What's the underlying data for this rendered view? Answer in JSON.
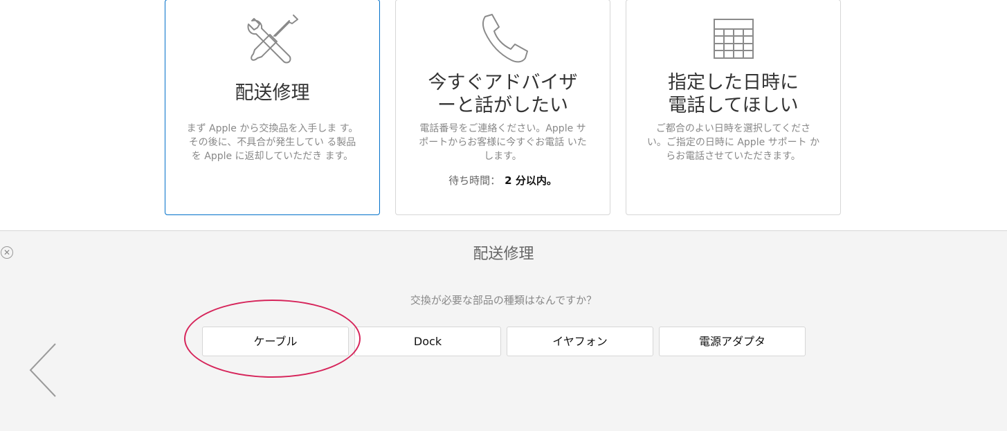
{
  "cards": [
    {
      "icon": "tools-icon",
      "title_lines": [
        "配送修理"
      ],
      "description": "まず Apple から交換品を入手しま す。その後に、不具合が発生してい る製品を Apple に返却していただき ます。",
      "selected": true
    },
    {
      "icon": "phone-icon",
      "title_lines": [
        "今すぐアドバイザ",
        "ーと話がしたい"
      ],
      "description": "電話番号をご連絡ください。Apple サポートからお客様に今すぐお電話 いたします。",
      "wait_label": "待ち時間：",
      "wait_value": "2 分以内。",
      "selected": false
    },
    {
      "icon": "calendar-icon",
      "title_lines": [
        "指定した日時に",
        "電話してほしい"
      ],
      "description": "ご都合のよい日時を選択してくださ い。ご指定の日時に Apple サポート からお電話させていただきます。",
      "selected": false
    }
  ],
  "panel": {
    "title": "配送修理",
    "close_icon": "close-icon",
    "question": "交換が必要な部品の種類はなんですか？",
    "options": [
      "ケーブル",
      "Dock",
      "イヤフォン",
      "電源アダプタ"
    ],
    "highlighted_option": "ケーブル",
    "highlight_color": "#d6245a",
    "back_icon": "chevron-left-icon"
  },
  "colors": {
    "selected_border": "#0070c9",
    "panel_background": "#f4f4f4"
  }
}
